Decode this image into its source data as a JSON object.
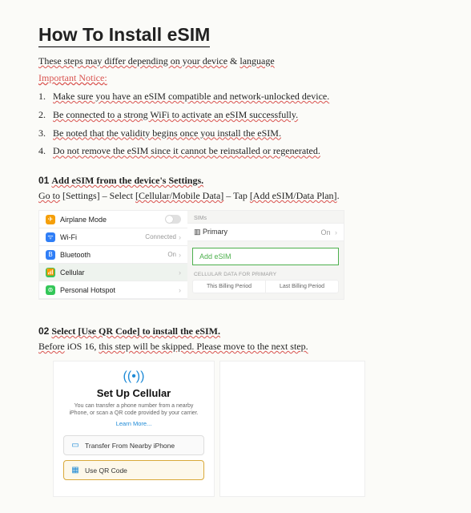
{
  "title": "How To Install eSIM",
  "intro_pre": "These steps may differ depending on your device",
  "intro_amp": " & ",
  "intro_post": "language",
  "important_label": "Important Notice",
  "notices": [
    "Make sure you have an eSIM compatible and network-unlocked device.",
    "Be connected to a strong WiFi to activate an eSIM successfully.",
    "Be noted that the validity begins once you install the eSIM.",
    "Do not remove the eSIM since it cannot be reinstalled or regenerated."
  ],
  "step1": {
    "num": "01",
    "title": "Add eSIM from the device's Settings.",
    "sub_a": "Go to",
    "sub_b": "[Settings]",
    "sub_c": "– Select",
    "sub_d": "[Cellular/Mobile Data]",
    "sub_e": "– Tap",
    "sub_f": "[Add eSIM/Data Plan]",
    "sub_g": "."
  },
  "settings": {
    "airplane": "Airplane Mode",
    "wifi": "Wi-Fi",
    "wifi_status": "Connected",
    "bluetooth": "Bluetooth",
    "bluetooth_status": "On",
    "cellular": "Cellular",
    "hotspot": "Personal Hotspot",
    "sims_label": "SIMs",
    "primary": "Primary",
    "primary_status": "On",
    "add_esim": "Add eSIM",
    "cell_data_label": "CELLULAR DATA FOR PRIMARY",
    "bill_this": "This Billing Period",
    "bill_last": "Last Billing Period"
  },
  "step2": {
    "num": "02",
    "title": "Select [Use QR Code] to install the eSIM.",
    "sub_a": "Before",
    "sub_b": "iOS 16,",
    "sub_c": "this step will be skipped. Please move to the next step."
  },
  "setup": {
    "heading": "Set Up Cellular",
    "body": "You can transfer a phone number from a nearby iPhone, or scan a QR code provided by your carrier.",
    "learn": "Learn More...",
    "opt1": "Transfer From Nearby iPhone",
    "opt2": "Use QR Code"
  }
}
